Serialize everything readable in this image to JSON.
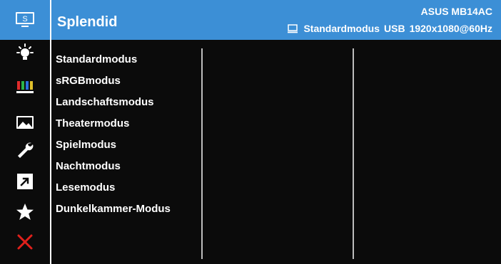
{
  "header": {
    "title": "Splendid",
    "model": "ASUS MB14AC",
    "status": {
      "mode": "Standardmodus",
      "input": "USB",
      "resolution": "1920x1080@60Hz"
    }
  },
  "sidebar": {
    "icons": [
      {
        "name": "splendid-icon",
        "label": "S"
      },
      {
        "name": "blue-light-filter-icon"
      },
      {
        "name": "color-icon"
      },
      {
        "name": "image-icon"
      },
      {
        "name": "system-setup-icon"
      },
      {
        "name": "shortcut-icon"
      },
      {
        "name": "favorite-icon"
      },
      {
        "name": "close-icon"
      }
    ]
  },
  "menu": {
    "items": [
      {
        "label": "Standardmodus"
      },
      {
        "label": "sRGBmodus"
      },
      {
        "label": "Landschaftsmodus"
      },
      {
        "label": "Theatermodus"
      },
      {
        "label": "Spielmodus"
      },
      {
        "label": "Nachtmodus"
      },
      {
        "label": "Lesemodus"
      },
      {
        "label": "Dunkelkammer-Modus"
      }
    ]
  },
  "colors": {
    "accent": "#3c8fd6",
    "background": "#0b0b0b",
    "close": "#e0201b"
  }
}
